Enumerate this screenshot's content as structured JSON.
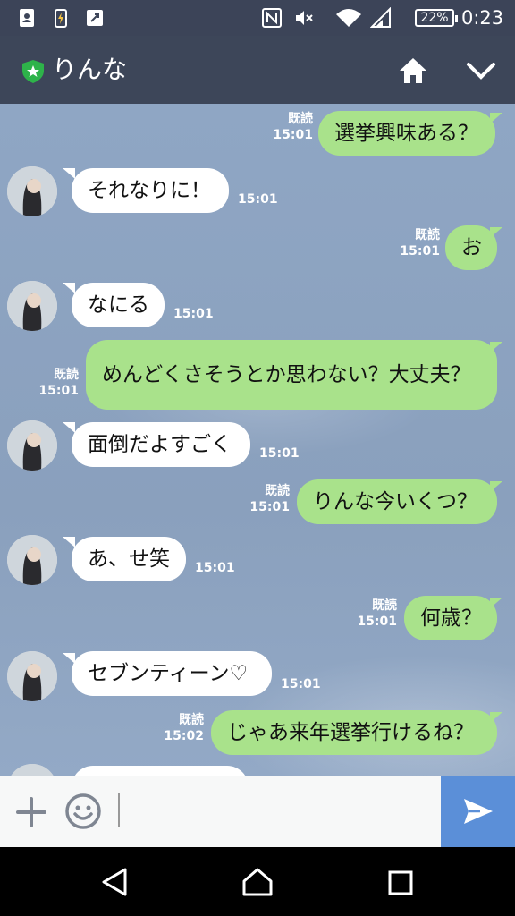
{
  "status_bar": {
    "battery_percent": "22%",
    "time": "0:23",
    "icons": [
      "contacts-icon",
      "battery-charging-icon",
      "screen-icon",
      "nfc-icon",
      "mute-icon",
      "wifi-icon",
      "signal-icon"
    ]
  },
  "header": {
    "title": "りんな",
    "icons": [
      "shield-star-icon",
      "home-icon",
      "chevron-down-icon"
    ]
  },
  "messages": [
    {
      "side": "out",
      "text": "選挙興味ある？",
      "read": "既読",
      "time": "15:01"
    },
    {
      "side": "in",
      "text": "それなりに！",
      "time": "15:01"
    },
    {
      "side": "out",
      "text": "お",
      "read": "既読",
      "time": "15:01"
    },
    {
      "side": "in",
      "text": "なにる",
      "time": "15:01"
    },
    {
      "side": "out",
      "text": "めんどくさそうとか思わない？大丈夫？",
      "read": "既読",
      "time": "15:01"
    },
    {
      "side": "in",
      "text": "面倒だよすごく",
      "time": "15:01"
    },
    {
      "side": "out",
      "text": "りんな今いくつ？",
      "read": "既読",
      "time": "15:01"
    },
    {
      "side": "in",
      "text": "あ、せ笑",
      "time": "15:01"
    },
    {
      "side": "out",
      "text": "何歳？",
      "read": "既読",
      "time": "15:01"
    },
    {
      "side": "in",
      "text": "セブンティーン♡",
      "time": "15:01"
    },
    {
      "side": "out",
      "text": "じゃあ来年選挙行けるね？",
      "read": "既読",
      "time": "15:02"
    }
  ],
  "input": {
    "value": "",
    "placeholder": "",
    "icons": [
      "plus-icon",
      "emoji-icon",
      "send-icon"
    ]
  },
  "colors": {
    "header_bg": "#3d4659",
    "chat_bg": "#8fa6c4",
    "outgoing_bubble": "#a9e28b",
    "incoming_bubble": "#ffffff",
    "send_button": "#5b8fd8"
  }
}
